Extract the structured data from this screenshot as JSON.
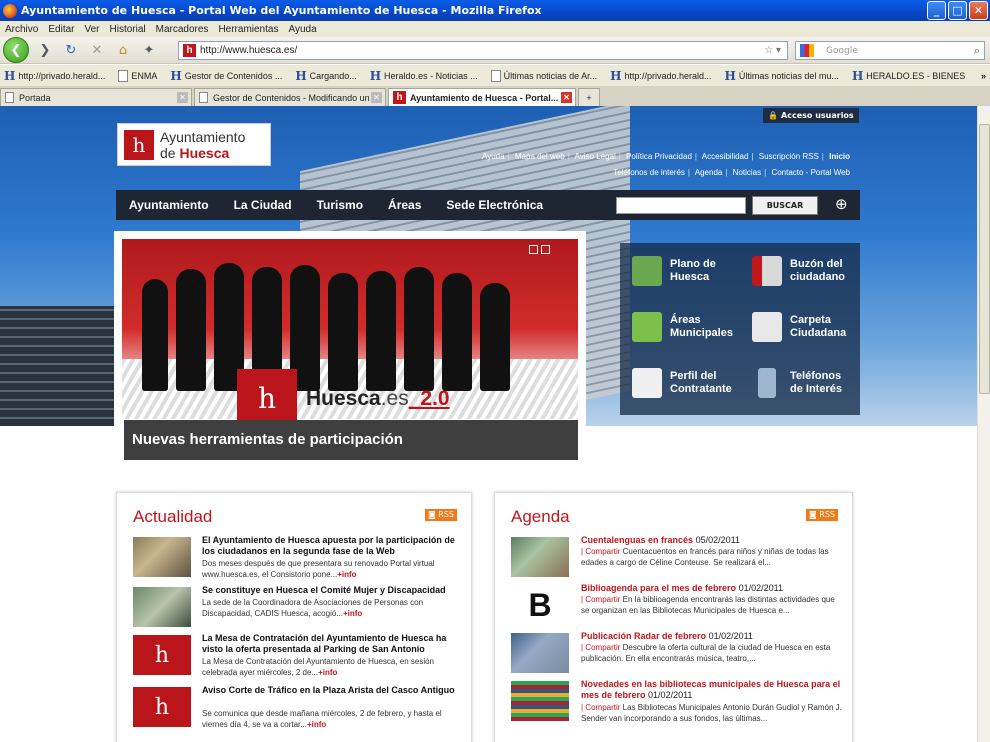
{
  "window": {
    "title": "Ayuntamiento de Huesca - Portal Web del Ayuntamiento de Huesca - Mozilla Firefox"
  },
  "menu": [
    "Archivo",
    "Editar",
    "Ver",
    "Historial",
    "Marcadores",
    "Herramientas",
    "Ayuda"
  ],
  "url": "http://www.huesca.es/",
  "search_placeholder": "Google",
  "bookmarks": [
    "http://privado.herald...",
    "ENMA",
    "Gestor de Contenidos ...",
    "Cargando...",
    "Heraldo.es - Noticias ...",
    "Últimas noticias de Ar...",
    "http://privado.herald...",
    "Últimas noticias del mu...",
    "HERALDO.ES - BIENES"
  ],
  "tabs": [
    "Portada",
    "Gestor de Contenidos - Modificando un ...",
    "Ayuntamiento de Huesca - Portal..."
  ],
  "site": {
    "logo_line1": "Ayuntamiento",
    "logo_line2a": "de",
    "logo_line2b": "Huesca",
    "access": "Acceso usuarios",
    "toplinks1": [
      "Ayuda",
      "Mapa del web",
      "Aviso Legal",
      "Política Privacidad",
      "Accesibilidad",
      "Suscripción RSS",
      "Inicio"
    ],
    "toplinks2": [
      "Teléfonos de interés",
      "Agenda",
      "Noticias",
      "Contacto - Portal Web"
    ],
    "nav": [
      "Ayuntamiento",
      "La Ciudad",
      "Turismo",
      "Áreas",
      "Sede Electrónica"
    ],
    "search_button": "BUSCAR",
    "banner_text_a": "Huesca",
    "banner_text_b": ".es",
    "banner_text_c": "_2.0",
    "banner_caption": "Nuevas herramientas de participación",
    "quick": [
      {
        "l1": "Plano de",
        "l2": "Huesca",
        "color": "#6aa84f"
      },
      {
        "l1": "Buzón del",
        "l2": "ciudadano",
        "color": "#d9d9d9"
      },
      {
        "l1": "Áreas",
        "l2": "Municipales",
        "color": "#7cc04b"
      },
      {
        "l1": "Carpeta",
        "l2": "Ciudadana",
        "color": "#e8e8e8"
      },
      {
        "l1": "Perfil del",
        "l2": "Contratante",
        "color": "#f0f0f0"
      },
      {
        "l1": "Teléfonos",
        "l2": "de Interés",
        "color": "#9fb6d1"
      }
    ]
  },
  "actualidad": {
    "title": "Actualidad",
    "rss": "RSS",
    "more": "+info",
    "items": [
      {
        "title": "El Ayuntamiento de Huesca apuesta por la participación de los ciudadanos en la segunda fase de la Web",
        "desc": "Dos meses después de que presentara su renovado Portal virtual www.huesca.es, el Consistorio pone..."
      },
      {
        "title": "Se constituye en Huesca el Comité Mujer y Discapacidad",
        "desc": "La sede de la  Coordinadora de Asociaciones de Personas con Discapacidad, CADIS Huesca, acogió..."
      },
      {
        "title": "La Mesa de Contratación del Ayuntamiento de Huesca ha visto la oferta presentada al Parking de San Antonio",
        "desc": "La Mesa de Contratación del Ayuntamiento de Huesca, en sesión celebrada ayer miércoles, 2 de..."
      },
      {
        "title": "Aviso Corte de Tráfico en la Plaza Arista del Casco Antiguo",
        "desc": "Se comunica que desde mañana miércoles, 2 de febrero, y hasta el viernes día 4, se va a cortar..."
      }
    ]
  },
  "agenda": {
    "title": "Agenda",
    "rss": "RSS",
    "share": "| Compartir",
    "items": [
      {
        "title": "Cuentalenguas en francés",
        "date": "05/02/2011",
        "desc": "Cuentacuentos en francés para niños y niñas de todas las edades a cargo de Céline Conteuse. Se realizará el..."
      },
      {
        "title": "Biblioagenda para el mes de febrero",
        "date": "01/02/2011",
        "desc": "En la biblioagenda encontrarás las distintas actividades que se organizan en las Bibliotecas Municipales de Huesca e..."
      },
      {
        "title": "Publicación Radar de febrero",
        "date": "01/02/2011",
        "desc": "Descubre la oferta cultural de la ciudad de Huesca en esta publicación. En ella encontrarás música, teatro,..."
      },
      {
        "title": "Novedades en las bibliotecas municipales de Huesca para el mes de febrero",
        "date": "01/02/2011",
        "desc": "Las Bibliotecas Municipales Antonio Durán Gudiol y Ramón J. Sender van incorporando a sus fondos, las últimas..."
      }
    ]
  }
}
